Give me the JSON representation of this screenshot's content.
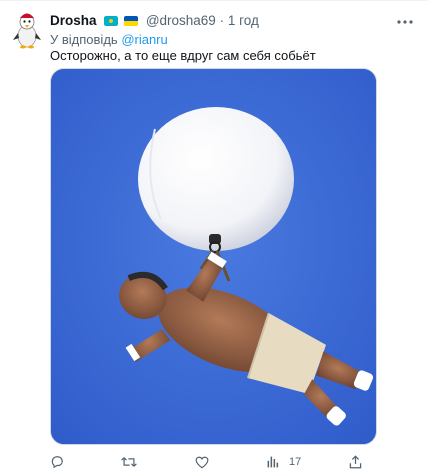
{
  "tweet": {
    "display_name": "Drosha",
    "handle": "@drosha69",
    "separator": "·",
    "time": "1 год",
    "reply_prefix": "У відповідь",
    "reply_handle": "@rianru",
    "text": "Осторожно, а то еще вдруг сам себя собьёт",
    "views_count": "17"
  },
  "icons": {
    "avatar": "penguin-avatar",
    "flag1": "kazakhstan-flag-icon",
    "flag2": "ukraine-flag-icon",
    "more": "more-dots-icon",
    "reply": "reply-icon",
    "retweet": "retweet-icon",
    "like": "heart-icon",
    "views": "views-chart-icon",
    "share": "share-icon"
  },
  "colors": {
    "accent": "#1d9bf0",
    "secondary_text": "#536471",
    "sky": "#3b6ad6"
  }
}
